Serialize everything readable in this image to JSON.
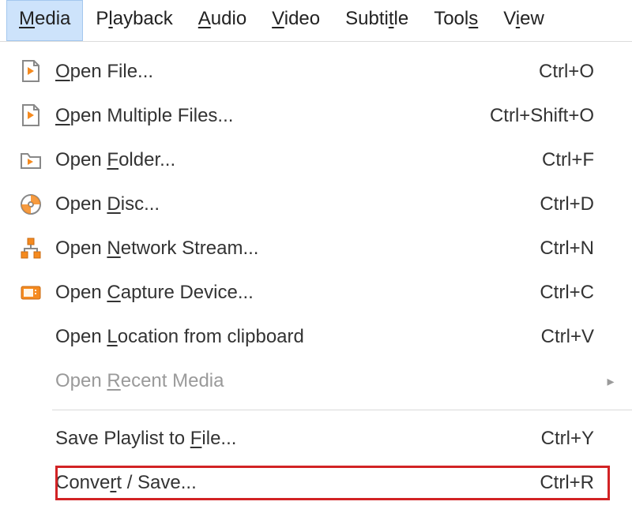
{
  "menubar": {
    "items": [
      {
        "pre": "",
        "ul": "M",
        "post": "edia",
        "active": true
      },
      {
        "pre": "P",
        "ul": "l",
        "post": "ayback",
        "active": false
      },
      {
        "pre": "",
        "ul": "A",
        "post": "udio",
        "active": false
      },
      {
        "pre": "",
        "ul": "V",
        "post": "ideo",
        "active": false
      },
      {
        "pre": "Subti",
        "ul": "t",
        "post": "le",
        "active": false
      },
      {
        "pre": "Tool",
        "ul": "s",
        "post": "",
        "active": false
      },
      {
        "pre": "V",
        "ul": "i",
        "post": "ew",
        "active": false
      }
    ]
  },
  "menu": {
    "items": [
      {
        "icon": "file-play",
        "pre": "",
        "ul": "O",
        "post": "pen File...",
        "shortcut": "Ctrl+O",
        "disabled": false,
        "submenu": false,
        "sep": false,
        "highlight": false
      },
      {
        "icon": "file-play",
        "pre": "",
        "ul": "O",
        "post": "pen Multiple Files...",
        "shortcut": "Ctrl+Shift+O",
        "disabled": false,
        "submenu": false,
        "sep": false,
        "highlight": false
      },
      {
        "icon": "folder-play",
        "pre": "Open ",
        "ul": "F",
        "post": "older...",
        "shortcut": "Ctrl+F",
        "disabled": false,
        "submenu": false,
        "sep": false,
        "highlight": false
      },
      {
        "icon": "disc",
        "pre": "Open ",
        "ul": "D",
        "post": "isc...",
        "shortcut": "Ctrl+D",
        "disabled": false,
        "submenu": false,
        "sep": false,
        "highlight": false
      },
      {
        "icon": "network",
        "pre": "Open ",
        "ul": "N",
        "post": "etwork Stream...",
        "shortcut": "Ctrl+N",
        "disabled": false,
        "submenu": false,
        "sep": false,
        "highlight": false
      },
      {
        "icon": "capture",
        "pre": "Open ",
        "ul": "C",
        "post": "apture Device...",
        "shortcut": "Ctrl+C",
        "disabled": false,
        "submenu": false,
        "sep": false,
        "highlight": false
      },
      {
        "icon": "",
        "pre": "Open ",
        "ul": "L",
        "post": "ocation from clipboard",
        "shortcut": "Ctrl+V",
        "disabled": false,
        "submenu": false,
        "sep": false,
        "highlight": false
      },
      {
        "icon": "",
        "pre": "Open ",
        "ul": "R",
        "post": "ecent Media",
        "shortcut": "",
        "disabled": true,
        "submenu": true,
        "sep": false,
        "highlight": false
      },
      {
        "sep": true
      },
      {
        "icon": "",
        "pre": "Save Playlist to ",
        "ul": "F",
        "post": "ile...",
        "shortcut": "Ctrl+Y",
        "disabled": false,
        "submenu": false,
        "sep": false,
        "highlight": false
      },
      {
        "icon": "",
        "pre": "Conve",
        "ul": "r",
        "post": "t / Save...",
        "shortcut": "Ctrl+R",
        "disabled": false,
        "submenu": false,
        "sep": false,
        "highlight": true
      }
    ]
  },
  "arrow_glyph": "▸"
}
